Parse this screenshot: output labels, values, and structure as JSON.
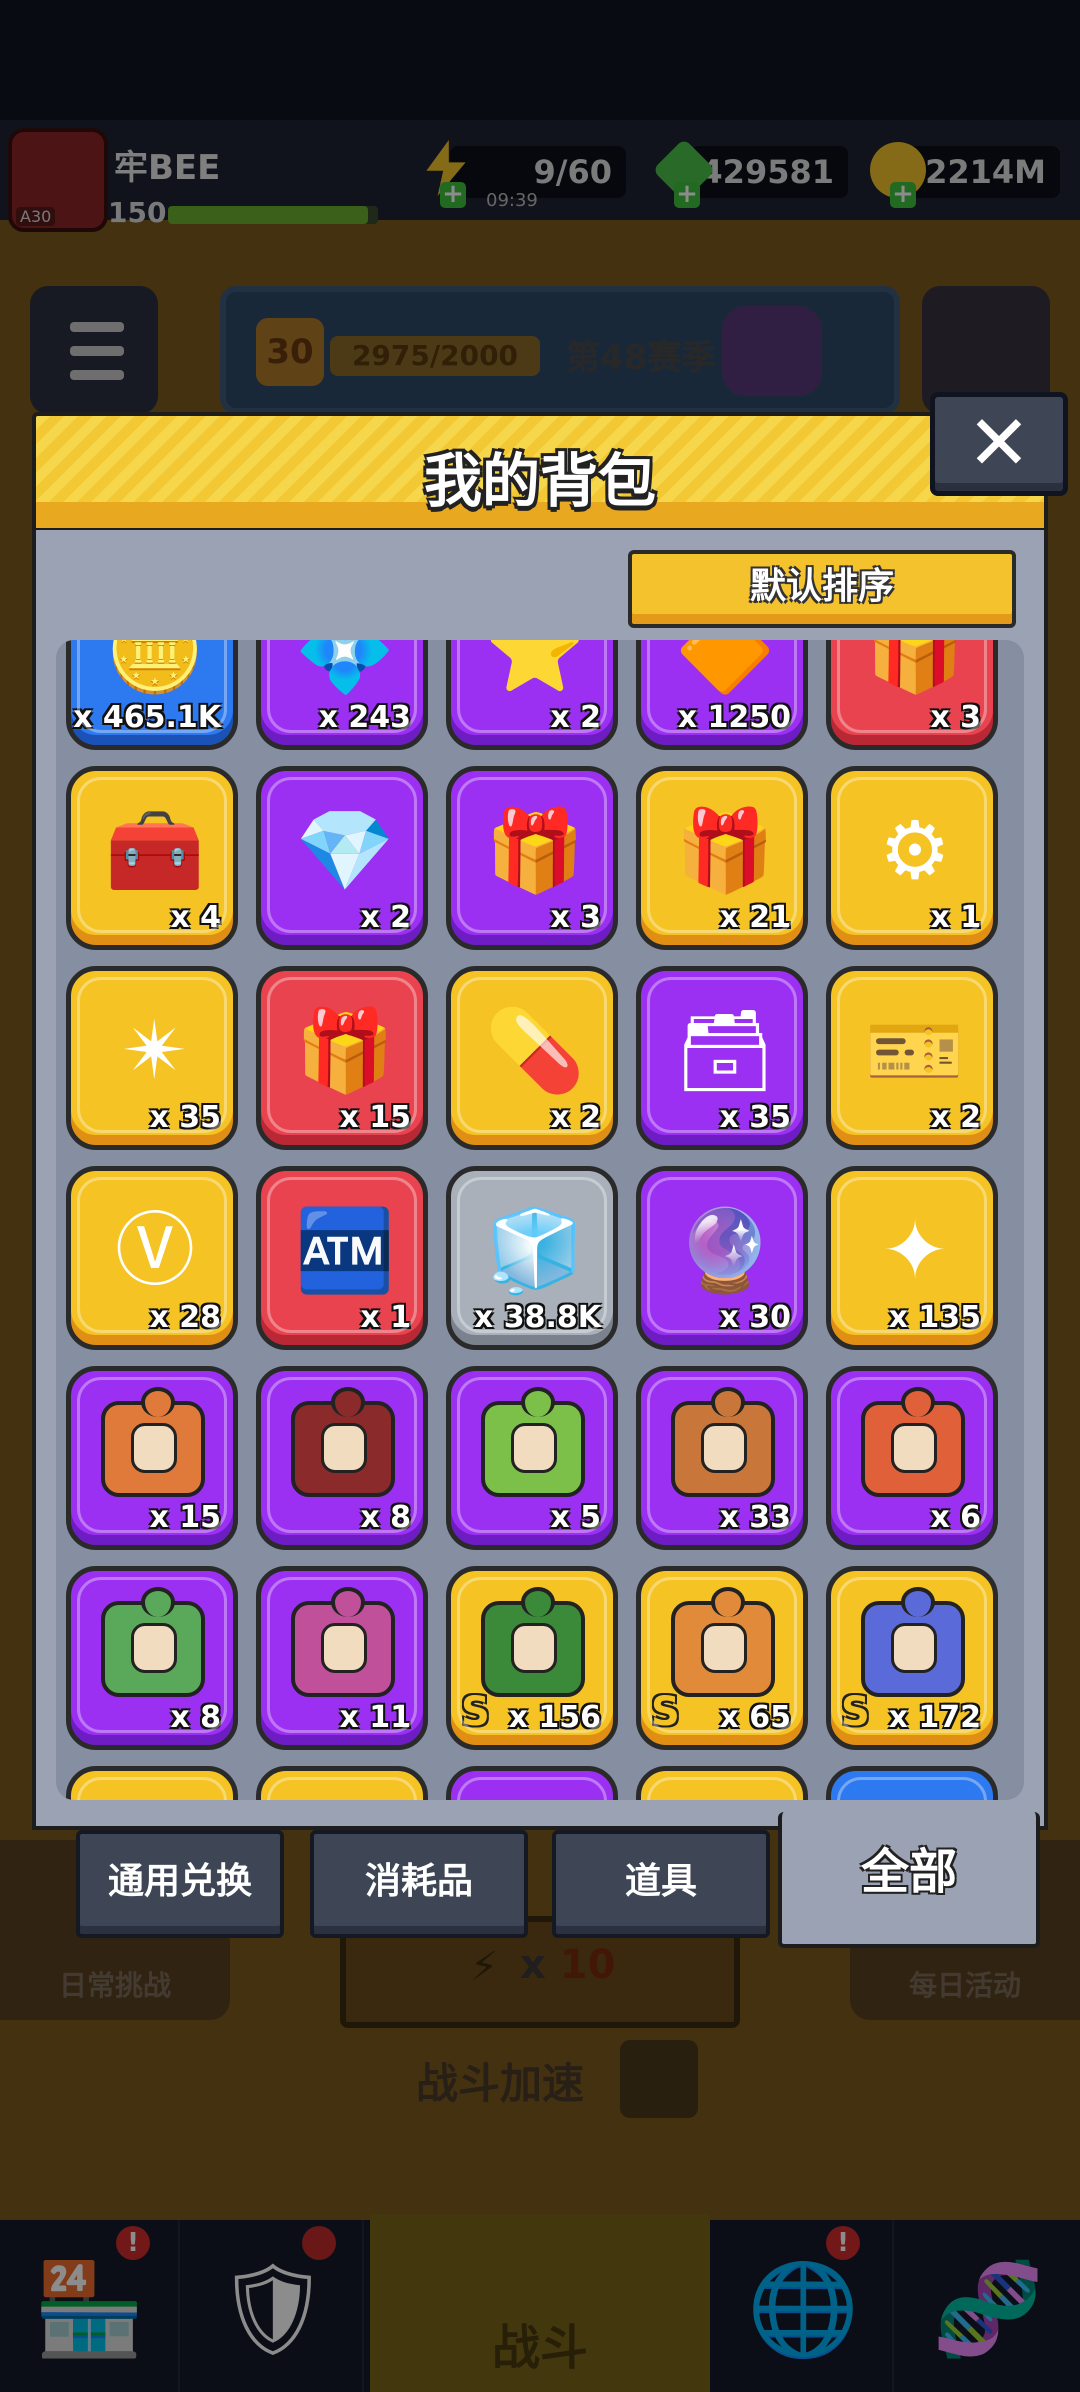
{
  "player": {
    "name": "牢BEE",
    "level": "150",
    "avatar_tag": "A30",
    "xp_fraction": 0.95
  },
  "resources": {
    "energy": "9/60",
    "energy_timer": "09:39",
    "gems": "429581",
    "coins": "2214M"
  },
  "season": {
    "tier": "30",
    "progress": "2975/2000",
    "title": "第48赛季"
  },
  "side_buttons": {
    "left": "日常挑战",
    "right": "每日活动"
  },
  "battle_speed": {
    "prefix": "x",
    "value": "10",
    "label": "战斗加速"
  },
  "bottom_nav": {
    "fight_label": "战斗",
    "badge": "!"
  },
  "backpack": {
    "title": "我的背包",
    "close_label": "✕",
    "sort_label": "默认排序",
    "items": [
      {
        "quality": "blue",
        "icon": "coin-pile-icon",
        "glyph": "🪙",
        "count": "x 465.1K"
      },
      {
        "quality": "purple",
        "icon": "purple-item-icon",
        "glyph": "💠",
        "count": "x 243"
      },
      {
        "quality": "purple",
        "icon": "purple-item-icon",
        "glyph": "⭐",
        "count": "x 2"
      },
      {
        "quality": "purple",
        "icon": "purple-item-icon",
        "glyph": "🔶",
        "count": "x 1250"
      },
      {
        "quality": "red",
        "icon": "red-item-icon",
        "glyph": "🎁",
        "count": "x 3"
      },
      {
        "quality": "gold",
        "icon": "gold-chest-icon",
        "glyph": "🧰",
        "count": "x 4"
      },
      {
        "quality": "purple",
        "icon": "diamond-card-icon",
        "glyph": "💎",
        "count": "x 2"
      },
      {
        "quality": "purple",
        "icon": "pink-gift-box-icon",
        "glyph": "🎁",
        "count": "x 3"
      },
      {
        "quality": "gold",
        "icon": "orange-gift-box-icon",
        "glyph": "🎁",
        "count": "x 21"
      },
      {
        "quality": "gold",
        "icon": "gear-core-icon",
        "glyph": "⚙",
        "count": "x 1"
      },
      {
        "quality": "gold",
        "icon": "star-crystal-icon",
        "glyph": "✴",
        "count": "x 35"
      },
      {
        "quality": "red",
        "icon": "red-gift-box-icon",
        "glyph": "🎁",
        "count": "x 15"
      },
      {
        "quality": "gold",
        "icon": "capsule-pill-icon",
        "glyph": "💊",
        "count": "x 2"
      },
      {
        "quality": "purple",
        "icon": "purple-chest-icon",
        "glyph": "🗃",
        "count": "x 35"
      },
      {
        "quality": "gold",
        "icon": "ticket-icon",
        "glyph": "🎫",
        "count": "x 2"
      },
      {
        "quality": "gold",
        "icon": "v-coin-icon",
        "glyph": "Ⓥ",
        "count": "x 28"
      },
      {
        "quality": "red",
        "icon": "vending-machine-icon",
        "glyph": "🏧",
        "count": "x 1"
      },
      {
        "quality": "grey",
        "icon": "metal-cube-icon",
        "glyph": "🧊",
        "count": "x 38.8K"
      },
      {
        "quality": "purple",
        "icon": "gem-orb-icon",
        "glyph": "🔮",
        "count": "x 30"
      },
      {
        "quality": "gold",
        "icon": "gold-star-icon",
        "glyph": "✦",
        "count": "x 135"
      },
      {
        "quality": "purple",
        "icon": "hero-puzzle-icon",
        "puzzle": "#e07a3a",
        "count": "x 15"
      },
      {
        "quality": "purple",
        "icon": "hero-puzzle-icon",
        "puzzle": "#8a2a2a",
        "count": "x 8"
      },
      {
        "quality": "purple",
        "icon": "hero-puzzle-icon",
        "puzzle": "#7cc04a",
        "count": "x 5"
      },
      {
        "quality": "purple",
        "icon": "hero-puzzle-icon",
        "puzzle": "#c8763a",
        "count": "x 33"
      },
      {
        "quality": "purple",
        "icon": "hero-puzzle-icon",
        "puzzle": "#e0603a",
        "count": "x 6"
      },
      {
        "quality": "purple",
        "icon": "hero-puzzle-icon",
        "puzzle": "#5aa85a",
        "count": "x 8"
      },
      {
        "quality": "purple",
        "icon": "hero-puzzle-icon",
        "puzzle": "#c0509a",
        "count": "x 11"
      },
      {
        "quality": "gold",
        "icon": "s-hero-puzzle-icon",
        "puzzle": "#3a8a3a",
        "s": "S",
        "count": "x 156"
      },
      {
        "quality": "gold",
        "icon": "s-hero-puzzle-icon",
        "puzzle": "#e08a3a",
        "s": "S",
        "count": "x 65"
      },
      {
        "quality": "gold",
        "icon": "s-hero-puzzle-icon",
        "puzzle": "#5a6ad8",
        "s": "S",
        "count": "x 172"
      },
      {
        "quality": "gold",
        "icon": "blue-puzzle-icon",
        "glyph": "🧩",
        "count": ""
      },
      {
        "quality": "gold",
        "icon": "hero-puzzle-icon",
        "glyph": "🧩",
        "count": ""
      },
      {
        "quality": "purple",
        "icon": "lotus-icon",
        "glyph": "🌸",
        "count": ""
      },
      {
        "quality": "gold",
        "icon": "gold-item-icon",
        "glyph": "🟨",
        "count": ""
      },
      {
        "quality": "blue",
        "icon": "blue-puzzle-icon",
        "glyph": "🧩",
        "count": ""
      }
    ],
    "tabs": [
      {
        "label": "通用兑换",
        "active": false
      },
      {
        "label": "消耗品",
        "active": false
      },
      {
        "label": "道具",
        "active": false
      },
      {
        "label": "全部",
        "active": true
      }
    ]
  },
  "colors": {
    "gold": "#f5c324",
    "purple": "#9b30f2",
    "red": "#e9434f",
    "grey": "#a9b0ba",
    "blue": "#2c79f0",
    "panel": "#9aa2b4"
  }
}
